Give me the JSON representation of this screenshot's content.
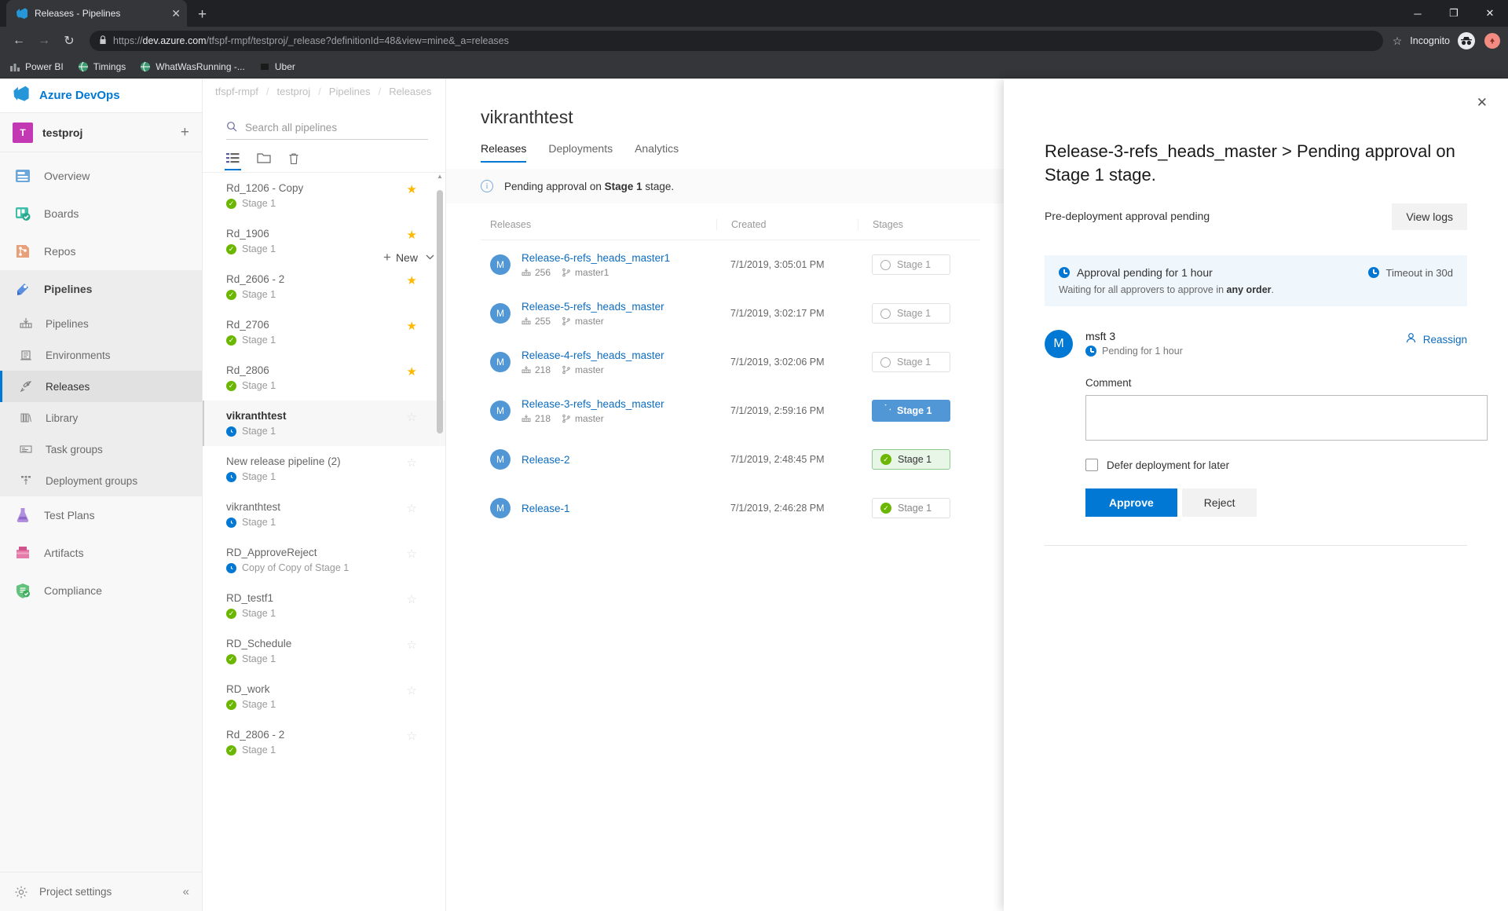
{
  "browser": {
    "tab_title": "Releases - Pipelines",
    "tab_close": "✕",
    "new_tab": "+",
    "win_minimize": "─",
    "win_maximize": "❐",
    "win_close": "✕",
    "back": "←",
    "forward": "→",
    "reload": "↻",
    "lock": "🔒",
    "url_scheme": "https://",
    "url_domain": "dev.azure.com",
    "url_path": "/tfspf-rmpf/testproj/_release?definitionId=48&view=mine&_a=releases",
    "star": "☆",
    "incognito_label": "Incognito",
    "incognito_glyph": "🕶",
    "profile_glyph": "▲",
    "bookmarks": [
      {
        "label": "Power BI",
        "icon": "chart-icon",
        "color": "#9aa0a6"
      },
      {
        "label": "Timings",
        "icon": "globe-icon",
        "color": "#3d9970"
      },
      {
        "label": "WhatWasRunning -...",
        "icon": "globe-icon",
        "color": "#3d9970"
      },
      {
        "label": "Uber",
        "icon": "square-icon",
        "color": "#1a1a1a"
      }
    ]
  },
  "leftnav": {
    "org_name": "Azure DevOps",
    "project_initial": "T",
    "project_name": "testproj",
    "add_project": "+",
    "items": [
      {
        "label": "Overview",
        "icon": "overview-icon",
        "state": "normal"
      },
      {
        "label": "Boards",
        "icon": "boards-icon",
        "state": "normal"
      },
      {
        "label": "Repos",
        "icon": "repos-icon",
        "state": "normal"
      },
      {
        "label": "Pipelines",
        "icon": "pipelines-icon",
        "state": "group-header"
      },
      {
        "label": "Pipelines",
        "icon": "pipelines-sub-icon",
        "state": "sub"
      },
      {
        "label": "Environments",
        "icon": "environments-icon",
        "state": "sub"
      },
      {
        "label": "Releases",
        "icon": "releases-rocket-icon",
        "state": "sub-active"
      },
      {
        "label": "Library",
        "icon": "library-icon",
        "state": "sub"
      },
      {
        "label": "Task groups",
        "icon": "task-groups-icon",
        "state": "sub"
      },
      {
        "label": "Deployment groups",
        "icon": "deployment-groups-icon",
        "state": "sub"
      },
      {
        "label": "Test Plans",
        "icon": "test-plans-icon",
        "state": "normal"
      },
      {
        "label": "Artifacts",
        "icon": "artifacts-icon",
        "state": "normal"
      },
      {
        "label": "Compliance",
        "icon": "compliance-icon",
        "state": "normal"
      }
    ],
    "project_settings": "Project settings",
    "collapse": "«"
  },
  "breadcrumb": [
    "tfspf-rmpf",
    "testproj",
    "Pipelines",
    "Releases"
  ],
  "pipelines_panel": {
    "search_placeholder": "Search all pipelines",
    "search_value": "",
    "toolbar": [
      {
        "name": "list-view-icon",
        "glyph": "☰",
        "active": true
      },
      {
        "name": "folder-icon",
        "glyph": "🗀",
        "active": false
      },
      {
        "name": "trash-icon",
        "glyph": "🗑",
        "active": false
      }
    ],
    "new_button": "New",
    "new_chevron": "∨",
    "items": [
      {
        "name": "Rd_1206 - Copy",
        "stage": "Stage 1",
        "status": "ok",
        "starred": true,
        "selected": false
      },
      {
        "name": "Rd_1906",
        "stage": "Stage 1",
        "status": "ok",
        "starred": true,
        "selected": false
      },
      {
        "name": "Rd_2606 - 2",
        "stage": "Stage 1",
        "status": "ok",
        "starred": true,
        "selected": false
      },
      {
        "name": "Rd_2706",
        "stage": "Stage 1",
        "status": "ok",
        "starred": true,
        "selected": false
      },
      {
        "name": "Rd_2806",
        "stage": "Stage 1",
        "status": "ok",
        "starred": true,
        "selected": false
      },
      {
        "name": "vikranthtest",
        "stage": "Stage 1",
        "status": "pending",
        "starred": false,
        "selected": true
      },
      {
        "name": "New release pipeline (2)",
        "stage": "Stage 1",
        "status": "pending",
        "starred": false,
        "selected": false
      },
      {
        "name": "vikranthtest",
        "stage": "Stage 1",
        "status": "pending",
        "starred": false,
        "selected": false
      },
      {
        "name": "RD_ApproveReject",
        "stage": "Copy of Copy of Stage 1",
        "status": "pending",
        "starred": false,
        "selected": false
      },
      {
        "name": "RD_testf1",
        "stage": "Stage 1",
        "status": "ok",
        "starred": false,
        "selected": false
      },
      {
        "name": "RD_Schedule",
        "stage": "Stage 1",
        "status": "ok",
        "starred": false,
        "selected": false
      },
      {
        "name": "RD_work",
        "stage": "Stage 1",
        "status": "ok",
        "starred": false,
        "selected": false
      },
      {
        "name": "Rd_2806 - 2",
        "stage": "Stage 1",
        "status": "ok",
        "starred": false,
        "selected": false
      }
    ]
  },
  "main": {
    "title": "vikranthtest",
    "tabs": [
      {
        "label": "Releases",
        "active": true
      },
      {
        "label": "Deployments",
        "active": false
      },
      {
        "label": "Analytics",
        "active": false
      }
    ],
    "info_prefix": "Pending approval on ",
    "info_bold": "Stage 1",
    "info_suffix": " stage.",
    "columns": {
      "releases": "Releases",
      "created": "Created",
      "stages": "Stages"
    },
    "rows": [
      {
        "avatar": "M",
        "name": "Release-6-refs_heads_master1",
        "build": "256",
        "branch": "master1",
        "created": "7/1/2019, 3:05:01 PM",
        "stage_label": "Stage 1",
        "stage_state": "notstarted"
      },
      {
        "avatar": "M",
        "name": "Release-5-refs_heads_master",
        "build": "255",
        "branch": "master",
        "created": "7/1/2019, 3:02:17 PM",
        "stage_label": "Stage 1",
        "stage_state": "notstarted"
      },
      {
        "avatar": "M",
        "name": "Release-4-refs_heads_master",
        "build": "218",
        "branch": "master",
        "created": "7/1/2019, 3:02:06 PM",
        "stage_label": "Stage 1",
        "stage_state": "notstarted"
      },
      {
        "avatar": "M",
        "name": "Release-3-refs_heads_master",
        "build": "218",
        "branch": "master",
        "created": "7/1/2019, 2:59:16 PM",
        "stage_label": "Stage 1",
        "stage_state": "inprogress"
      },
      {
        "avatar": "M",
        "name": "Release-2",
        "build": "",
        "branch": "",
        "created": "7/1/2019, 2:48:45 PM",
        "stage_label": "Stage 1",
        "stage_state": "succeeded-hl"
      },
      {
        "avatar": "M",
        "name": "Release-1",
        "build": "",
        "branch": "",
        "created": "7/1/2019, 2:46:28 PM",
        "stage_label": "Stage 1",
        "stage_state": "succeeded"
      }
    ]
  },
  "panel": {
    "close": "✕",
    "title": "Release-3-refs_heads_master > Pending approval on Stage 1 stage.",
    "subtitle": "Pre-deployment approval pending",
    "view_logs": "View logs",
    "pending_text": "Approval pending for 1 hour",
    "timeout_text": "Timeout in 30d",
    "waiting_prefix": "Waiting for all approvers to approve in ",
    "waiting_bold": "any order",
    "waiting_suffix": ".",
    "approver_initial": "M",
    "approver_name": "msft 3",
    "approver_status": "Pending for 1 hour",
    "reassign": "Reassign",
    "comment_label": "Comment",
    "comment_value": "",
    "defer_label": "Defer deployment for later",
    "defer_checked": false,
    "approve": "Approve",
    "reject": "Reject"
  },
  "colors": {
    "accent": "#0078d4",
    "success": "#6bb700",
    "link": "#0d6cbf",
    "star": "#ffb900",
    "project": "#c239b3"
  }
}
